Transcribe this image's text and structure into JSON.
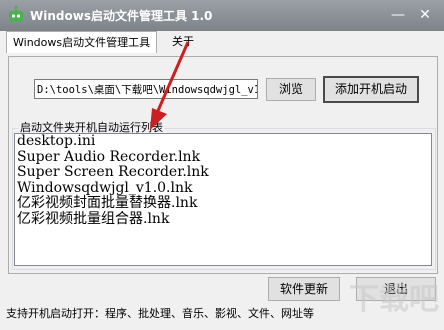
{
  "window": {
    "title": "Windows启动文件管理工具 1.0",
    "minimize_glyph": "—",
    "close_glyph": "✕"
  },
  "tabs": [
    {
      "label": "Windows启动文件管理工具"
    },
    {
      "label": "关于"
    }
  ],
  "toolbar": {
    "path_value": "D:\\tools\\桌面\\下载吧\\Windowsqdwjgl_v1",
    "browse_label": "浏览",
    "add_startup_label": "添加开机启动"
  },
  "list": {
    "group_title": "启动文件夹开机自动运行列表",
    "items": [
      "desktop.ini",
      "Super Audio Recorder.lnk",
      "Super Screen Recorder.lnk",
      "Windowsqdwjgl_v1.0.lnk",
      "亿彩视频封面批量替换器.lnk",
      "亿彩视频批量组合器.lnk"
    ]
  },
  "footer": {
    "refresh_label": "软件更新",
    "exit_label": "退出",
    "status_text": "支持开机启动打开：程序、批处理、音乐、影视、文件、网址等"
  },
  "colors": {
    "titlebar": "#8a9096",
    "window_bg": "#f0f0f0",
    "arrow": "#cc1f1f"
  },
  "icons": {
    "app": "robot-icon",
    "annotation": "red-arrow-annotation"
  }
}
